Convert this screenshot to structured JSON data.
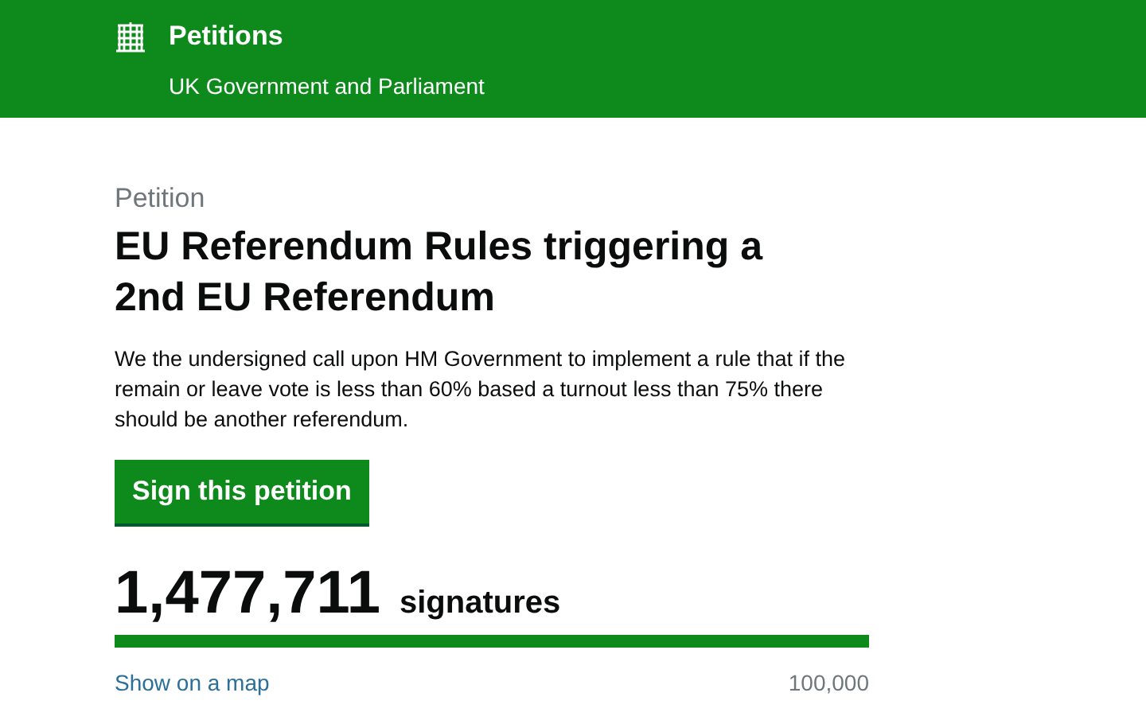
{
  "header": {
    "title": "Petitions",
    "subtitle": "UK Government and Parliament"
  },
  "petition": {
    "label": "Petition",
    "title": "EU Referendum Rules triggering a 2nd EU Referendum",
    "description": "We the undersigned call upon HM Government to implement a rule that if the remain or leave vote is less than 60% based a turnout less than 75% there should be another referendum.",
    "sign_button": "Sign this petition"
  },
  "signatures": {
    "count": "1,477,711",
    "unit": "signatures",
    "progress": {
      "level": 1
    },
    "map_link": "Show on a map",
    "threshold": "100,000"
  }
}
